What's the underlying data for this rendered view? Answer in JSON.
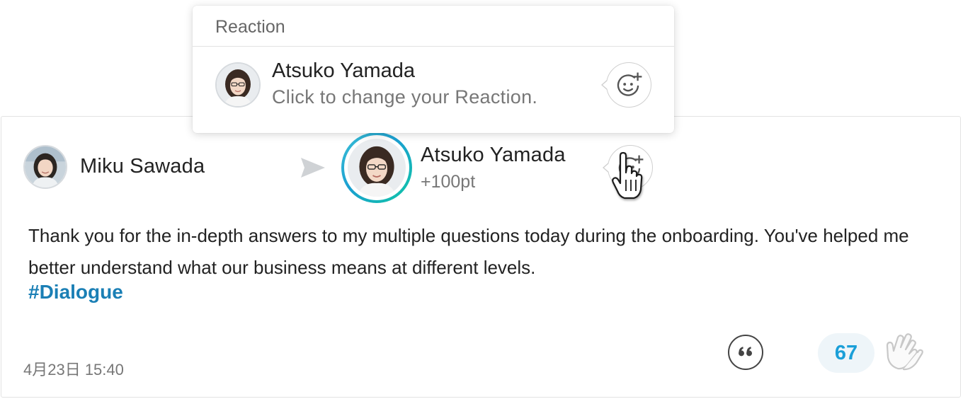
{
  "post": {
    "sender": {
      "name": "Miku Sawada"
    },
    "recipient": {
      "name": "Atsuko Yamada",
      "points": "+100pt"
    },
    "message": "Thank you for the in-depth answers to my multiple questions today during the onboarding. You've helped me better understand what our business means at different levels.",
    "hashtag": "#Dialogue",
    "timestamp": "4月23日 15:40",
    "clap_count": "67"
  },
  "popover": {
    "title": "Reaction",
    "user_name": "Atsuko Yamada",
    "hint": "Click to change your Reaction."
  },
  "icons": {
    "send": "paper-plane-icon",
    "reaction": "add-emoji-icon",
    "quote": "quote-icon",
    "clap": "clapping-hands-icon",
    "cursor": "hand-pointer-icon"
  },
  "colors": {
    "accent": "#1a9fd8",
    "hashtag": "#1a7fb5",
    "recipient_ring_start": "#3cc0d6",
    "recipient_ring_end": "#10c7a4",
    "clap_badge_bg": "#eef5f9"
  }
}
